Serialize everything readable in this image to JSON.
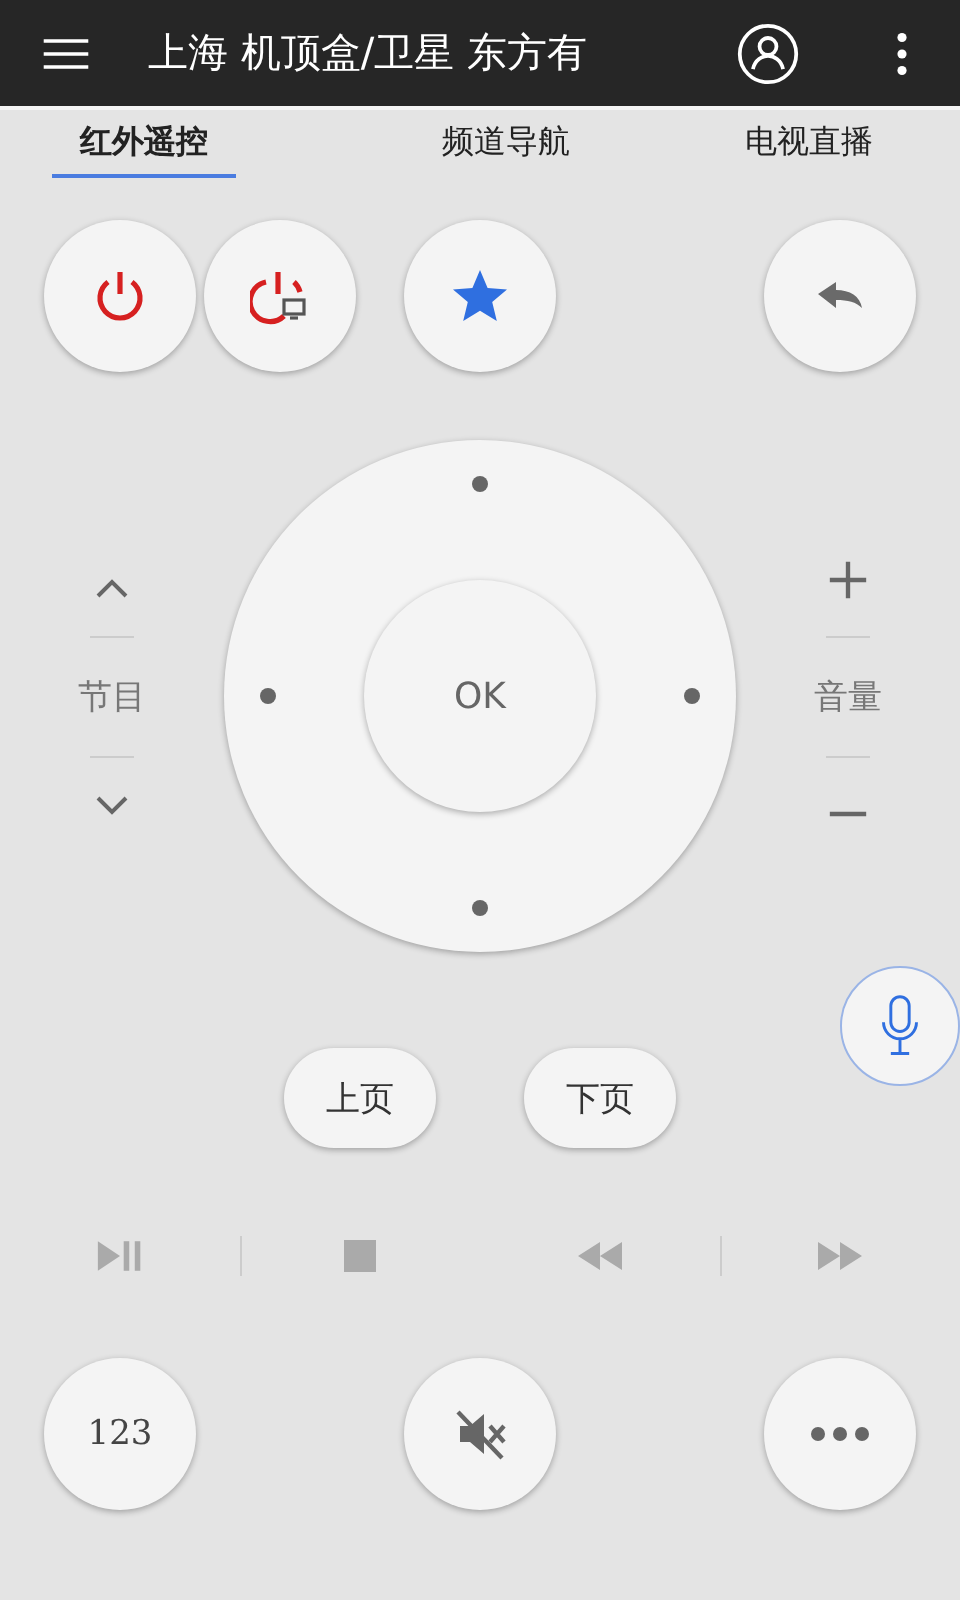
{
  "header": {
    "title": "上海 机顶盒/卫星 东方有"
  },
  "tabs": [
    {
      "label": "红外遥控",
      "selected": true
    },
    {
      "label": "频道导航",
      "selected": false
    },
    {
      "label": "电视直播",
      "selected": false
    }
  ],
  "dpad": {
    "left_label": "节目",
    "right_label": "音量",
    "ok": "OK"
  },
  "page_buttons": [
    "上页",
    "下页"
  ],
  "bottom": {
    "number_button": "123"
  }
}
